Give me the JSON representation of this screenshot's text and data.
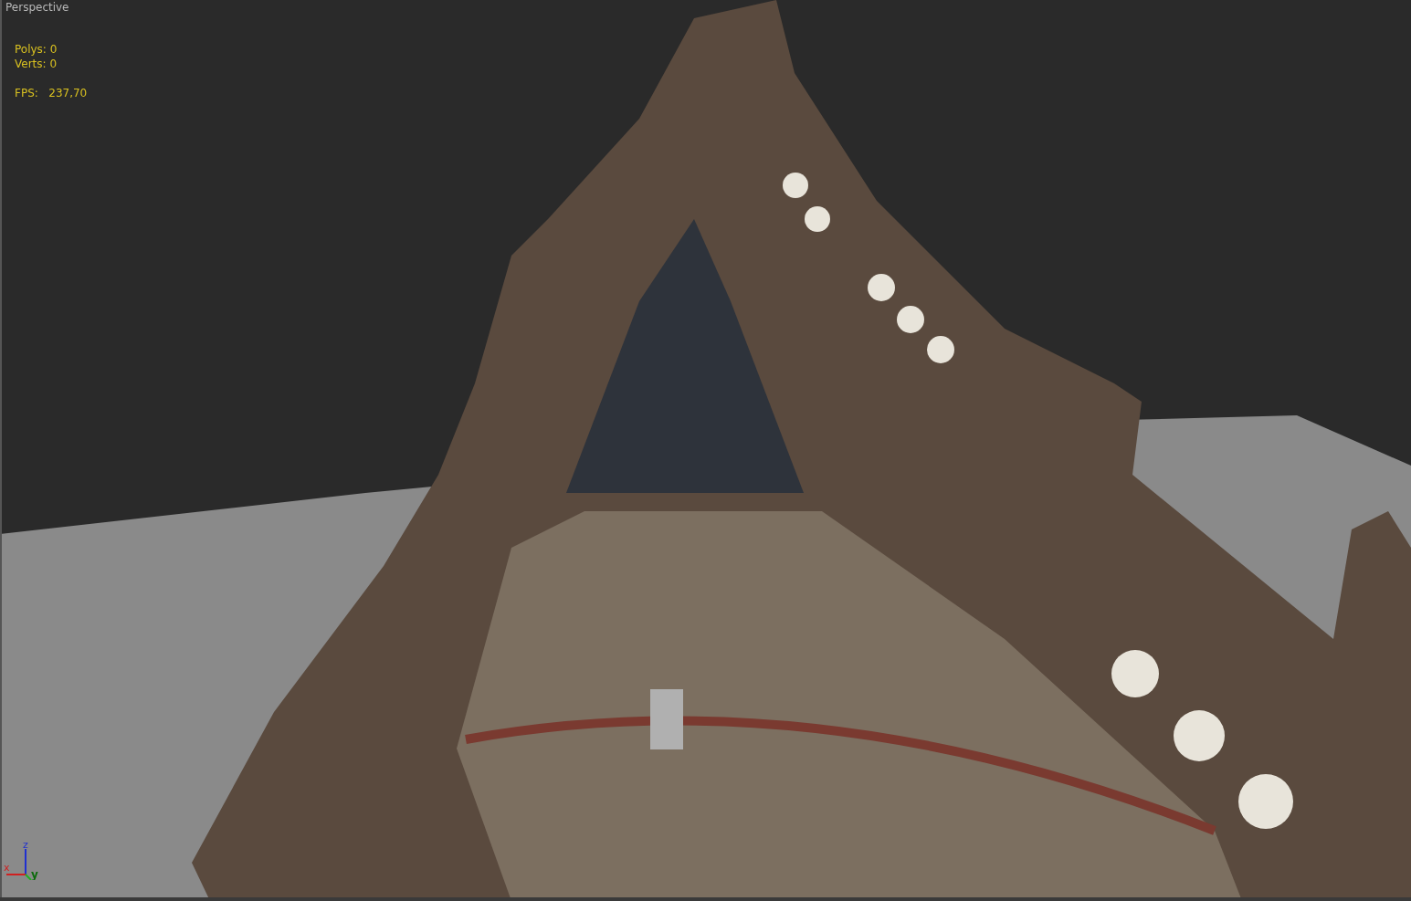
{
  "viewport": {
    "label": "Perspective"
  },
  "stats": [
    {
      "label": "Polys:",
      "value": "0"
    },
    {
      "label": "Verts:",
      "value": "0"
    }
  ],
  "fps": {
    "label": "FPS:",
    "value": "237,70"
  },
  "axis": {
    "x": "x",
    "y": "y",
    "z": "z"
  }
}
